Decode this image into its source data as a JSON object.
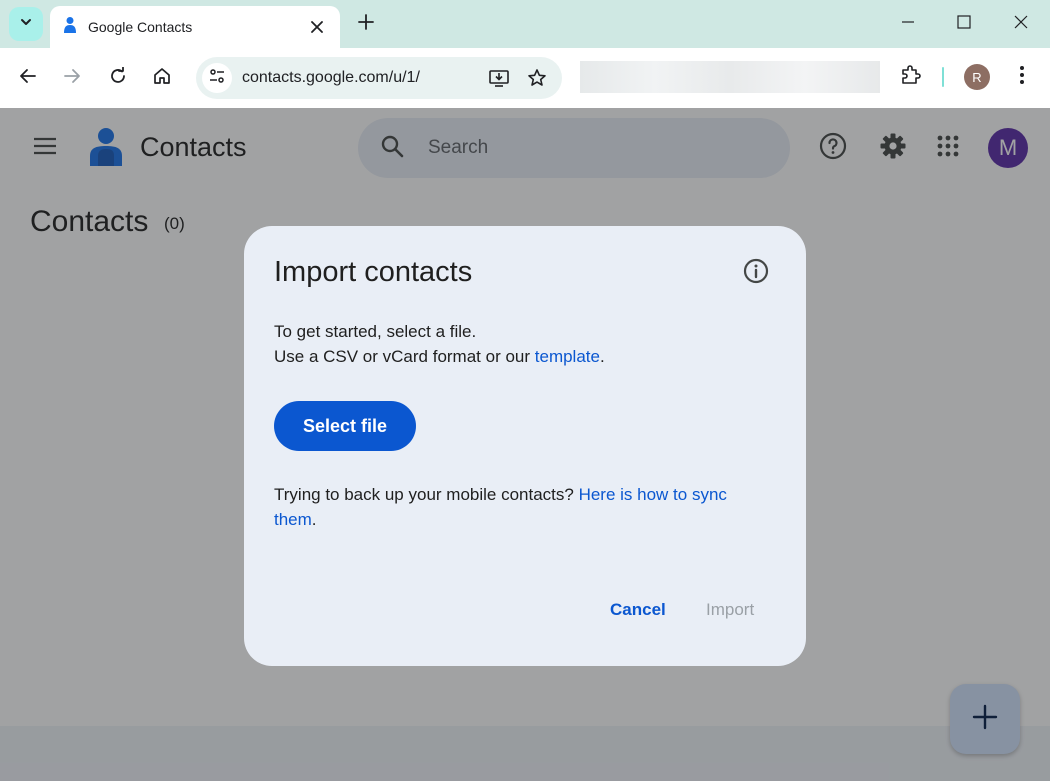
{
  "browser": {
    "tab_title": "Google Contacts",
    "url": "contacts.google.com/u/1/",
    "profile_initial": "R",
    "accent": "#cfe8e3"
  },
  "app": {
    "name": "Contacts",
    "search_placeholder": "Search",
    "avatar_initial": "M"
  },
  "page": {
    "title": "Contacts",
    "count": "(0)"
  },
  "dialog": {
    "title": "Import contacts",
    "line1": "To get started, select a file.",
    "line2_prefix": "Use a CSV or vCard format or our ",
    "line2_link": "template",
    "line2_suffix": ".",
    "select_button": "Select file",
    "backup_text": "Trying to back up your mobile contacts? ",
    "backup_link": "Here is how to sync them",
    "backup_suffix": ".",
    "cancel_label": "Cancel",
    "import_label": "Import"
  },
  "icons": {
    "tab_search": "chevron-down-icon",
    "favicon": "contacts-favicon-icon",
    "close": "close-icon",
    "new_tab": "plus-icon",
    "minimize": "minimize-icon",
    "maximize": "maximize-icon",
    "window_close": "close-icon",
    "back": "arrow-left-icon",
    "forward": "arrow-right-icon",
    "reload": "reload-icon",
    "home": "home-icon",
    "site_info": "tune-icon",
    "install": "install-app-icon",
    "bookmark": "star-icon",
    "extensions": "puzzle-icon",
    "menu": "more-vert-icon",
    "hamburger": "menu-icon",
    "search": "search-icon",
    "help": "help-icon",
    "settings": "gear-icon",
    "apps": "apps-grid-icon",
    "info": "info-icon",
    "fab": "plus-icon"
  }
}
